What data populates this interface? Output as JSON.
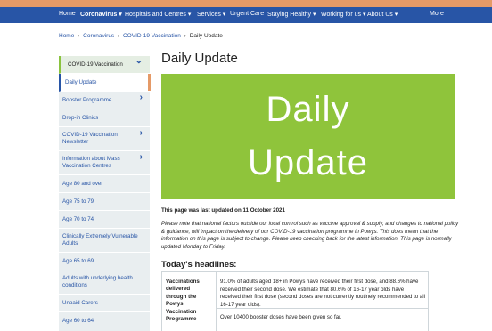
{
  "nav": {
    "items": [
      "Home",
      "Coronavirus",
      "Hospitals and Centres",
      "Services",
      "Urgent Care",
      "Staying Healthy",
      "Working for us",
      "About Us"
    ],
    "more": "More",
    "dropdown_glyph": "▾"
  },
  "breadcrumb": {
    "home": "Home",
    "coronavirus": "Coronavirus",
    "vaccination": "COVID-19 Vaccination",
    "current": "Daily Update",
    "separator": "›"
  },
  "sidebar": {
    "items": [
      "COVID-19 Vaccination",
      "Daily Update",
      "Booster Programme",
      "Drop-in Clinics",
      "COVID-19 Vaccination Newsletter",
      "Information about Mass Vaccination Centres",
      "Age 80 and over",
      "Age 75 to 79",
      "Age 70 to 74",
      "Clinically Extremely Vulnerable Adults",
      "Age 65 to 69",
      "Adults with underlying health conditions",
      "Unpaid Carers",
      "Age 60 to 64"
    ],
    "chevron_right": "›",
    "chevron_down": "⌄"
  },
  "main": {
    "title": "Daily Update",
    "hero_line1": "Daily",
    "hero_line2": "Update",
    "updated": "This page was last updated on 11 October 2021",
    "note": "Please note that national factors outside our local control such as vaccine approval & supply, and changes to national policy & guidance, will impact on the delivery of our COVID-19 vaccination programme in Powys. This does mean that the information on this page is subject to change. Please keep checking back for the latest information. This page is normally updated Monday to Friday.",
    "headlines": "Today's headlines:",
    "table": {
      "label": "Vaccinations delivered through the Powys Vaccination Programme",
      "text1": "91.0% of adults aged 18+ in Powys have received their first dose, and 88.6% have received their second dose. We estimate that 80.6% of 16-17 year olds have received their first dose (second doses are not currently routinely recommended to all 16-17 year olds).",
      "text2": "Over 10400 booster doses have been given so far."
    }
  },
  "colors": {
    "nav_bg": "#2855a6",
    "top_strip": "#e59a67",
    "hero_bg": "#8fc43b",
    "sidebar_bg": "#e9eef0",
    "link": "#2855a6"
  }
}
